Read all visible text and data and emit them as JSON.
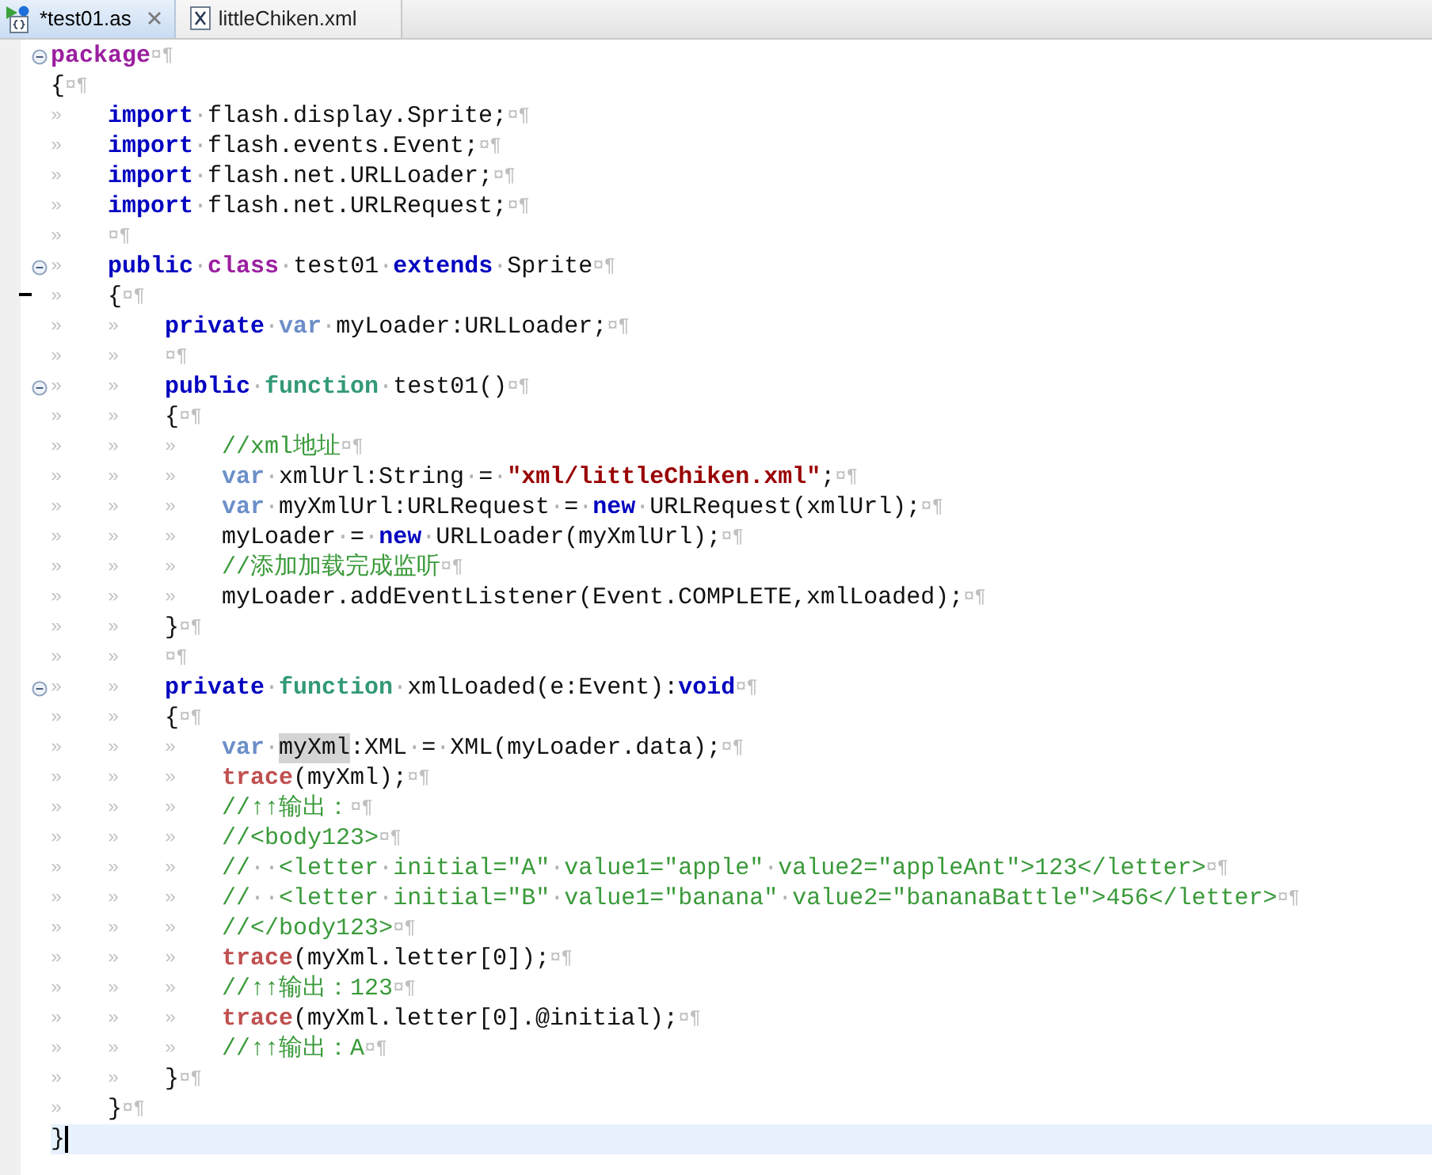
{
  "tabs": [
    {
      "label": "*test01.as",
      "kind": "script",
      "selected": true
    },
    {
      "label": "littleChiken.xml",
      "kind": "xml",
      "selected": false
    }
  ],
  "editor": {
    "lines": [
      {
        "fold": true,
        "changed": false,
        "current": false,
        "tokens": [
          {
            "kind": "kw2",
            "text": "package"
          },
          {
            "kind": "eol",
            "text": "¤¶"
          }
        ]
      },
      {
        "fold": false,
        "changed": false,
        "current": false,
        "tokens": [
          {
            "kind": "txt",
            "text": "{"
          },
          {
            "kind": "eol",
            "text": "¤¶"
          }
        ]
      },
      {
        "fold": false,
        "changed": false,
        "current": false,
        "tokens": [
          {
            "kind": "tab",
            "text": "»"
          },
          {
            "kind": "kw",
            "text": "import"
          },
          {
            "kind": "dot",
            "text": "·"
          },
          {
            "kind": "txt",
            "text": "flash.display.Sprite;"
          },
          {
            "kind": "eol",
            "text": "¤¶"
          }
        ]
      },
      {
        "fold": false,
        "changed": false,
        "current": false,
        "tokens": [
          {
            "kind": "tab",
            "text": "»"
          },
          {
            "kind": "kw",
            "text": "import"
          },
          {
            "kind": "dot",
            "text": "·"
          },
          {
            "kind": "txt",
            "text": "flash.events.Event;"
          },
          {
            "kind": "eol",
            "text": "¤¶"
          }
        ]
      },
      {
        "fold": false,
        "changed": false,
        "current": false,
        "tokens": [
          {
            "kind": "tab",
            "text": "»"
          },
          {
            "kind": "kw",
            "text": "import"
          },
          {
            "kind": "dot",
            "text": "·"
          },
          {
            "kind": "txt",
            "text": "flash.net.URLLoader;"
          },
          {
            "kind": "eol",
            "text": "¤¶"
          }
        ]
      },
      {
        "fold": false,
        "changed": false,
        "current": false,
        "tokens": [
          {
            "kind": "tab",
            "text": "»"
          },
          {
            "kind": "kw",
            "text": "import"
          },
          {
            "kind": "dot",
            "text": "·"
          },
          {
            "kind": "txt",
            "text": "flash.net.URLRequest;"
          },
          {
            "kind": "eol",
            "text": "¤¶"
          }
        ]
      },
      {
        "fold": false,
        "changed": false,
        "current": false,
        "tokens": [
          {
            "kind": "tab",
            "text": "»"
          },
          {
            "kind": "eol",
            "text": "¤¶"
          }
        ]
      },
      {
        "fold": true,
        "changed": false,
        "current": false,
        "tokens": [
          {
            "kind": "tab",
            "text": "»"
          },
          {
            "kind": "kw",
            "text": "public"
          },
          {
            "kind": "dot",
            "text": "·"
          },
          {
            "kind": "kw2",
            "text": "class"
          },
          {
            "kind": "dot",
            "text": "·"
          },
          {
            "kind": "txt",
            "text": "test01"
          },
          {
            "kind": "dot",
            "text": "·"
          },
          {
            "kind": "kw",
            "text": "extends"
          },
          {
            "kind": "dot",
            "text": "·"
          },
          {
            "kind": "txt",
            "text": "Sprite"
          },
          {
            "kind": "eol",
            "text": "¤¶"
          }
        ]
      },
      {
        "fold": false,
        "changed": true,
        "current": false,
        "tokens": [
          {
            "kind": "tab",
            "text": "»"
          },
          {
            "kind": "txt",
            "text": "{"
          },
          {
            "kind": "eol",
            "text": "¤¶"
          }
        ]
      },
      {
        "fold": false,
        "changed": false,
        "current": false,
        "tokens": [
          {
            "kind": "tab",
            "text": "»"
          },
          {
            "kind": "tab",
            "text": "»"
          },
          {
            "kind": "kw",
            "text": "private"
          },
          {
            "kind": "dot",
            "text": "·"
          },
          {
            "kind": "var",
            "text": "var"
          },
          {
            "kind": "dot",
            "text": "·"
          },
          {
            "kind": "txt",
            "text": "myLoader:URLLoader;"
          },
          {
            "kind": "eol",
            "text": "¤¶"
          }
        ]
      },
      {
        "fold": false,
        "changed": false,
        "current": false,
        "tokens": [
          {
            "kind": "tab",
            "text": "»"
          },
          {
            "kind": "tab",
            "text": "»"
          },
          {
            "kind": "eol",
            "text": "¤¶"
          }
        ]
      },
      {
        "fold": true,
        "changed": false,
        "current": false,
        "tokens": [
          {
            "kind": "tab",
            "text": "»"
          },
          {
            "kind": "tab",
            "text": "»"
          },
          {
            "kind": "kw",
            "text": "public"
          },
          {
            "kind": "dot",
            "text": "·"
          },
          {
            "kind": "fn",
            "text": "function"
          },
          {
            "kind": "dot",
            "text": "·"
          },
          {
            "kind": "txt",
            "text": "test01()"
          },
          {
            "kind": "eol",
            "text": "¤¶"
          }
        ]
      },
      {
        "fold": false,
        "changed": false,
        "current": false,
        "tokens": [
          {
            "kind": "tab",
            "text": "»"
          },
          {
            "kind": "tab",
            "text": "»"
          },
          {
            "kind": "txt",
            "text": "{"
          },
          {
            "kind": "eol",
            "text": "¤¶"
          }
        ]
      },
      {
        "fold": false,
        "changed": false,
        "current": false,
        "tokens": [
          {
            "kind": "tab",
            "text": "»"
          },
          {
            "kind": "tab",
            "text": "»"
          },
          {
            "kind": "tab",
            "text": "»"
          },
          {
            "kind": "cmt",
            "text": "//xml地址"
          },
          {
            "kind": "eol",
            "text": "¤¶"
          }
        ]
      },
      {
        "fold": false,
        "changed": false,
        "current": false,
        "tokens": [
          {
            "kind": "tab",
            "text": "»"
          },
          {
            "kind": "tab",
            "text": "»"
          },
          {
            "kind": "tab",
            "text": "»"
          },
          {
            "kind": "var",
            "text": "var"
          },
          {
            "kind": "dot",
            "text": "·"
          },
          {
            "kind": "txt",
            "text": "xmlUrl:String"
          },
          {
            "kind": "dot",
            "text": "·"
          },
          {
            "kind": "txt",
            "text": "="
          },
          {
            "kind": "dot",
            "text": "·"
          },
          {
            "kind": "str",
            "text": "\"xml/littleChiken.xml\""
          },
          {
            "kind": "txt",
            "text": ";"
          },
          {
            "kind": "eol",
            "text": "¤¶"
          }
        ]
      },
      {
        "fold": false,
        "changed": false,
        "current": false,
        "tokens": [
          {
            "kind": "tab",
            "text": "»"
          },
          {
            "kind": "tab",
            "text": "»"
          },
          {
            "kind": "tab",
            "text": "»"
          },
          {
            "kind": "var",
            "text": "var"
          },
          {
            "kind": "dot",
            "text": "·"
          },
          {
            "kind": "txt",
            "text": "myXmlUrl:URLRequest"
          },
          {
            "kind": "dot",
            "text": "·"
          },
          {
            "kind": "txt",
            "text": "="
          },
          {
            "kind": "dot",
            "text": "·"
          },
          {
            "kind": "kw",
            "text": "new"
          },
          {
            "kind": "dot",
            "text": "·"
          },
          {
            "kind": "txt",
            "text": "URLRequest(xmlUrl);"
          },
          {
            "kind": "eol",
            "text": "¤¶"
          }
        ]
      },
      {
        "fold": false,
        "changed": false,
        "current": false,
        "tokens": [
          {
            "kind": "tab",
            "text": "»"
          },
          {
            "kind": "tab",
            "text": "»"
          },
          {
            "kind": "tab",
            "text": "»"
          },
          {
            "kind": "txt",
            "text": "myLoader"
          },
          {
            "kind": "dot",
            "text": "·"
          },
          {
            "kind": "txt",
            "text": "="
          },
          {
            "kind": "dot",
            "text": "·"
          },
          {
            "kind": "kw",
            "text": "new"
          },
          {
            "kind": "dot",
            "text": "·"
          },
          {
            "kind": "txt",
            "text": "URLLoader(myXmlUrl);"
          },
          {
            "kind": "eol",
            "text": "¤¶"
          }
        ]
      },
      {
        "fold": false,
        "changed": false,
        "current": false,
        "tokens": [
          {
            "kind": "tab",
            "text": "»"
          },
          {
            "kind": "tab",
            "text": "»"
          },
          {
            "kind": "tab",
            "text": "»"
          },
          {
            "kind": "cmt",
            "text": "//添加加载完成监听"
          },
          {
            "kind": "eol",
            "text": "¤¶"
          }
        ]
      },
      {
        "fold": false,
        "changed": false,
        "current": false,
        "tokens": [
          {
            "kind": "tab",
            "text": "»"
          },
          {
            "kind": "tab",
            "text": "»"
          },
          {
            "kind": "tab",
            "text": "»"
          },
          {
            "kind": "txt",
            "text": "myLoader.addEventListener(Event.COMPLETE,xmlLoaded);"
          },
          {
            "kind": "eol",
            "text": "¤¶"
          }
        ]
      },
      {
        "fold": false,
        "changed": false,
        "current": false,
        "tokens": [
          {
            "kind": "tab",
            "text": "»"
          },
          {
            "kind": "tab",
            "text": "»"
          },
          {
            "kind": "txt",
            "text": "}"
          },
          {
            "kind": "eol",
            "text": "¤¶"
          }
        ]
      },
      {
        "fold": false,
        "changed": false,
        "current": false,
        "tokens": [
          {
            "kind": "tab",
            "text": "»"
          },
          {
            "kind": "tab",
            "text": "»"
          },
          {
            "kind": "eol",
            "text": "¤¶"
          }
        ]
      },
      {
        "fold": true,
        "changed": false,
        "current": false,
        "tokens": [
          {
            "kind": "tab",
            "text": "»"
          },
          {
            "kind": "tab",
            "text": "»"
          },
          {
            "kind": "kw",
            "text": "private"
          },
          {
            "kind": "dot",
            "text": "·"
          },
          {
            "kind": "fn",
            "text": "function"
          },
          {
            "kind": "dot",
            "text": "·"
          },
          {
            "kind": "txt",
            "text": "xmlLoaded(e:Event):"
          },
          {
            "kind": "kw",
            "text": "void"
          },
          {
            "kind": "eol",
            "text": "¤¶"
          }
        ]
      },
      {
        "fold": false,
        "changed": false,
        "current": false,
        "tokens": [
          {
            "kind": "tab",
            "text": "»"
          },
          {
            "kind": "tab",
            "text": "»"
          },
          {
            "kind": "txt",
            "text": "{"
          },
          {
            "kind": "eol",
            "text": "¤¶"
          }
        ]
      },
      {
        "fold": false,
        "changed": false,
        "current": false,
        "tokens": [
          {
            "kind": "tab",
            "text": "»"
          },
          {
            "kind": "tab",
            "text": "»"
          },
          {
            "kind": "tab",
            "text": "»"
          },
          {
            "kind": "var",
            "text": "var"
          },
          {
            "kind": "dot",
            "text": "·"
          },
          {
            "kind": "txt",
            "text": "myXml",
            "highlighted": true
          },
          {
            "kind": "txt",
            "text": ":XML"
          },
          {
            "kind": "dot",
            "text": "·"
          },
          {
            "kind": "txt",
            "text": "="
          },
          {
            "kind": "dot",
            "text": "·"
          },
          {
            "kind": "txt",
            "text": "XML(myLoader.data);"
          },
          {
            "kind": "eol",
            "text": "¤¶"
          }
        ]
      },
      {
        "fold": false,
        "changed": false,
        "current": false,
        "tokens": [
          {
            "kind": "tab",
            "text": "»"
          },
          {
            "kind": "tab",
            "text": "»"
          },
          {
            "kind": "tab",
            "text": "»"
          },
          {
            "kind": "trace",
            "text": "trace"
          },
          {
            "kind": "txt",
            "text": "(myXml);"
          },
          {
            "kind": "eol",
            "text": "¤¶"
          }
        ]
      },
      {
        "fold": false,
        "changed": false,
        "current": false,
        "tokens": [
          {
            "kind": "tab",
            "text": "»"
          },
          {
            "kind": "tab",
            "text": "»"
          },
          {
            "kind": "tab",
            "text": "»"
          },
          {
            "kind": "cmt",
            "text": "//↑↑输出："
          },
          {
            "kind": "eol",
            "text": "¤¶"
          }
        ]
      },
      {
        "fold": false,
        "changed": false,
        "current": false,
        "tokens": [
          {
            "kind": "tab",
            "text": "»"
          },
          {
            "kind": "tab",
            "text": "»"
          },
          {
            "kind": "tab",
            "text": "»"
          },
          {
            "kind": "cmt",
            "text": "//<body123>"
          },
          {
            "kind": "eol",
            "text": "¤¶"
          }
        ]
      },
      {
        "fold": false,
        "changed": false,
        "current": false,
        "tokens": [
          {
            "kind": "tab",
            "text": "»"
          },
          {
            "kind": "tab",
            "text": "»"
          },
          {
            "kind": "tab",
            "text": "»"
          },
          {
            "kind": "cmt",
            "text": "//"
          },
          {
            "kind": "dot",
            "text": "··"
          },
          {
            "kind": "cmt",
            "text": "<letter"
          },
          {
            "kind": "dot",
            "text": "·"
          },
          {
            "kind": "cmt",
            "text": "initial=\"A\""
          },
          {
            "kind": "dot",
            "text": "·"
          },
          {
            "kind": "cmt",
            "text": "value1=\"apple\""
          },
          {
            "kind": "dot",
            "text": "·"
          },
          {
            "kind": "cmt",
            "text": "value2=\"appleAnt\">123</letter>"
          },
          {
            "kind": "eol",
            "text": "¤¶"
          }
        ]
      },
      {
        "fold": false,
        "changed": false,
        "current": false,
        "tokens": [
          {
            "kind": "tab",
            "text": "»"
          },
          {
            "kind": "tab",
            "text": "»"
          },
          {
            "kind": "tab",
            "text": "»"
          },
          {
            "kind": "cmt",
            "text": "//"
          },
          {
            "kind": "dot",
            "text": "··"
          },
          {
            "kind": "cmt",
            "text": "<letter"
          },
          {
            "kind": "dot",
            "text": "·"
          },
          {
            "kind": "cmt",
            "text": "initial=\"B\""
          },
          {
            "kind": "dot",
            "text": "·"
          },
          {
            "kind": "cmt",
            "text": "value1=\"banana\""
          },
          {
            "kind": "dot",
            "text": "·"
          },
          {
            "kind": "cmt",
            "text": "value2=\"bananaBattle\">456</letter>"
          },
          {
            "kind": "eol",
            "text": "¤¶"
          }
        ]
      },
      {
        "fold": false,
        "changed": false,
        "current": false,
        "tokens": [
          {
            "kind": "tab",
            "text": "»"
          },
          {
            "kind": "tab",
            "text": "»"
          },
          {
            "kind": "tab",
            "text": "»"
          },
          {
            "kind": "cmt",
            "text": "//</body123>"
          },
          {
            "kind": "eol",
            "text": "¤¶"
          }
        ]
      },
      {
        "fold": false,
        "changed": false,
        "current": false,
        "tokens": [
          {
            "kind": "tab",
            "text": "»"
          },
          {
            "kind": "tab",
            "text": "»"
          },
          {
            "kind": "tab",
            "text": "»"
          },
          {
            "kind": "trace",
            "text": "trace"
          },
          {
            "kind": "txt",
            "text": "(myXml.letter[0]);"
          },
          {
            "kind": "eol",
            "text": "¤¶"
          }
        ]
      },
      {
        "fold": false,
        "changed": false,
        "current": false,
        "tokens": [
          {
            "kind": "tab",
            "text": "»"
          },
          {
            "kind": "tab",
            "text": "»"
          },
          {
            "kind": "tab",
            "text": "»"
          },
          {
            "kind": "cmt",
            "text": "//↑↑输出：123"
          },
          {
            "kind": "eol",
            "text": "¤¶"
          }
        ]
      },
      {
        "fold": false,
        "changed": false,
        "current": false,
        "tokens": [
          {
            "kind": "tab",
            "text": "»"
          },
          {
            "kind": "tab",
            "text": "»"
          },
          {
            "kind": "tab",
            "text": "»"
          },
          {
            "kind": "trace",
            "text": "trace"
          },
          {
            "kind": "txt",
            "text": "(myXml.letter[0].@initial);"
          },
          {
            "kind": "eol",
            "text": "¤¶"
          }
        ]
      },
      {
        "fold": false,
        "changed": false,
        "current": false,
        "tokens": [
          {
            "kind": "tab",
            "text": "»"
          },
          {
            "kind": "tab",
            "text": "»"
          },
          {
            "kind": "tab",
            "text": "»"
          },
          {
            "kind": "cmt",
            "text": "//↑↑输出：A"
          },
          {
            "kind": "eol",
            "text": "¤¶"
          }
        ]
      },
      {
        "fold": false,
        "changed": false,
        "current": false,
        "tokens": [
          {
            "kind": "tab",
            "text": "»"
          },
          {
            "kind": "tab",
            "text": "»"
          },
          {
            "kind": "txt",
            "text": "}"
          },
          {
            "kind": "eol",
            "text": "¤¶"
          }
        ]
      },
      {
        "fold": false,
        "changed": false,
        "current": false,
        "tokens": [
          {
            "kind": "tab",
            "text": "»"
          },
          {
            "kind": "txt",
            "text": "}"
          },
          {
            "kind": "eol",
            "text": "¤¶"
          }
        ]
      },
      {
        "fold": false,
        "changed": false,
        "current": true,
        "tokens": [
          {
            "kind": "txt",
            "text": "}"
          }
        ]
      }
    ]
  }
}
